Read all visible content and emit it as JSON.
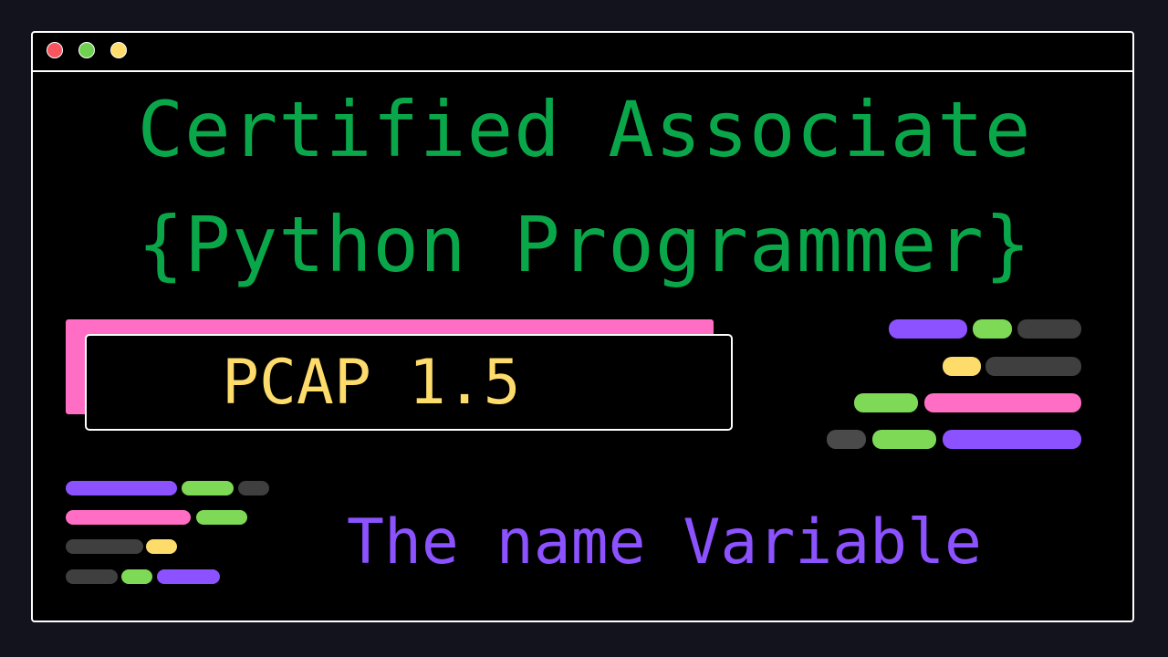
{
  "window": {
    "controls": [
      {
        "name": "close-dot",
        "color": "#f8555f"
      },
      {
        "name": "minimize-dot",
        "color": "#6fd14f"
      },
      {
        "name": "maximize-dot",
        "color": "#fddc6c"
      }
    ]
  },
  "title": {
    "line1": "Certified Associate",
    "line2": "{Python Programmer}"
  },
  "version_badge": {
    "text": "PCAP 1.5"
  },
  "topic": {
    "text": "The name Variable"
  },
  "colors": {
    "background": "#13131d",
    "window": "#000000",
    "title_green": "#0aa74a",
    "version_yellow": "#fddc6c",
    "topic_purple": "#8c52ff",
    "accent_pink": "#ff6ec4",
    "code_purple": "#8c52ff",
    "code_green": "#7ed957",
    "code_gray": "#3f3f3f",
    "code_yellow": "#fddc6c",
    "code_pink": "#ff6ec4"
  },
  "decor": {
    "code_lines_right": [
      [
        "purple",
        "green",
        "gray"
      ],
      [
        "yellow",
        "gray"
      ],
      [
        "green",
        "pink"
      ],
      [
        "gray",
        "green",
        "purple"
      ]
    ],
    "code_lines_left": [
      [
        "purple",
        "green",
        "gray"
      ],
      [
        "pink",
        "green"
      ],
      [
        "gray",
        "yellow"
      ],
      [
        "gray",
        "green",
        "purple"
      ]
    ]
  }
}
